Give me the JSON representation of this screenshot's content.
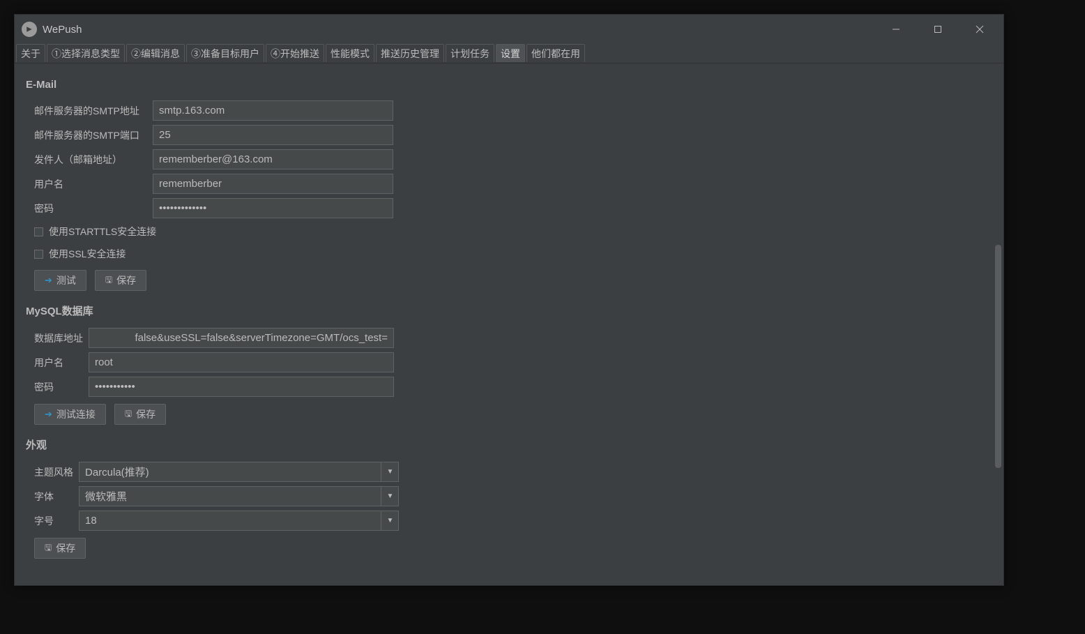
{
  "app": {
    "title": "WePush"
  },
  "tabs": [
    {
      "label": "关于"
    },
    {
      "label": "①选择消息类型"
    },
    {
      "label": "②编辑消息"
    },
    {
      "label": "③准备目标用户"
    },
    {
      "label": "④开始推送"
    },
    {
      "label": "性能模式"
    },
    {
      "label": "推送历史管理"
    },
    {
      "label": "计划任务"
    },
    {
      "label": "设置",
      "active": true
    },
    {
      "label": "他们都在用"
    }
  ],
  "email": {
    "heading": "E-Mail",
    "smtp_addr_label": "邮件服务器的SMTP地址",
    "smtp_addr_value": "smtp.163.com",
    "smtp_port_label": "邮件服务器的SMTP端口",
    "smtp_port_value": "25",
    "sender_label": "发件人（邮箱地址）",
    "sender_value": "rememberber@163.com",
    "user_label": "用户名",
    "user_value": "rememberber",
    "pass_label": "密码",
    "pass_value": "•••••••••••••",
    "starttls_label": "使用STARTTLS安全连接",
    "ssl_label": "使用SSL安全连接",
    "test_btn": "测试",
    "save_btn": "保存"
  },
  "db": {
    "heading": "MySQL数据库",
    "url_label": "数据库地址",
    "url_value": "=false&useSSL=false&serverTimezone=GMT/ocs_test",
    "user_label": "用户名",
    "user_value": "root",
    "pass_label": "密码",
    "pass_value": "•••••••••••",
    "test_btn": "测试连接",
    "save_btn": "保存"
  },
  "appearance": {
    "heading": "外观",
    "theme_label": "主题风格",
    "theme_value": "Darcula(推荐)",
    "font_label": "字体",
    "font_value": "微软雅黑",
    "size_label": "字号",
    "size_value": "18",
    "save_btn": "保存"
  }
}
